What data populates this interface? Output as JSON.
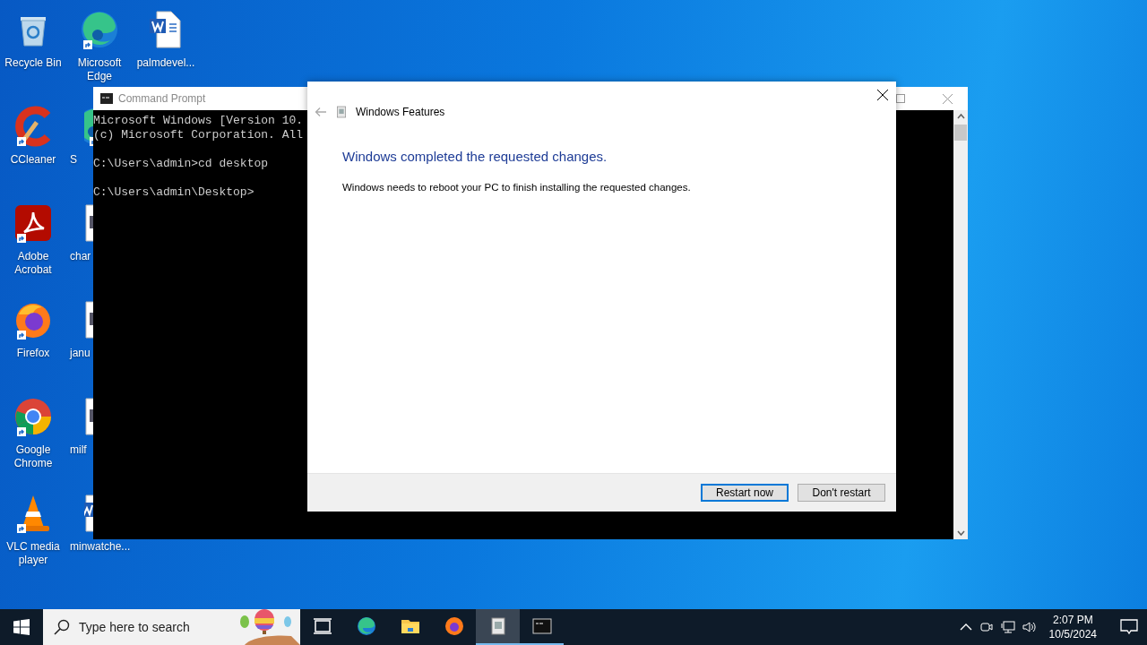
{
  "desktop_columns": [
    [
      {
        "label": "Recycle Bin",
        "kind": "recycle",
        "shortcut": false
      },
      {
        "label": "CCleaner",
        "kind": "ccleaner",
        "shortcut": true
      },
      {
        "label": "Adobe Acrobat",
        "kind": "acrobat",
        "shortcut": true
      },
      {
        "label": "Firefox",
        "kind": "firefox",
        "shortcut": true
      },
      {
        "label": "Google Chrome",
        "kind": "chrome",
        "shortcut": true
      },
      {
        "label": "VLC media player",
        "kind": "vlc",
        "shortcut": true
      }
    ],
    [
      {
        "label": "Microsoft Edge",
        "kind": "edge",
        "shortcut": true
      },
      {
        "label": "S",
        "kind": "edge",
        "shortcut": true
      },
      {
        "label": "char",
        "kind": "doc",
        "shortcut": false
      },
      {
        "label": "janu",
        "kind": "doc",
        "shortcut": false
      },
      {
        "label": "milf",
        "kind": "doc",
        "shortcut": false
      },
      {
        "label": "minwatche...",
        "kind": "word",
        "shortcut": false
      }
    ],
    [
      {
        "label": "palmdevel...",
        "kind": "word",
        "shortcut": false
      }
    ]
  ],
  "console_window": {
    "title": "Command Prompt",
    "blocks": [
      [
        "Microsoft Windows [Version 10.",
        "(c) Microsoft Corporation. All"
      ],
      [
        "C:\\Users\\admin>cd desktop"
      ],
      [
        "C:\\Users\\admin\\Desktop>"
      ]
    ]
  },
  "dialog": {
    "title": "Windows Features",
    "heading": "Windows completed the requested changes.",
    "message": "Windows needs to reboot your PC to finish installing the requested changes.",
    "buttons": [
      {
        "label": "Restart now",
        "default": true
      },
      {
        "label": "Don't restart",
        "default": false
      }
    ]
  },
  "taskbar": {
    "search": {
      "placeholder": "Type here to search"
    },
    "apps": [
      {
        "kind": "taskview",
        "selected": false,
        "open": false
      },
      {
        "kind": "edge",
        "selected": false,
        "open": false
      },
      {
        "kind": "folder",
        "selected": false,
        "open": false
      },
      {
        "kind": "firefox",
        "selected": false,
        "open": false
      },
      {
        "kind": "features",
        "selected": true,
        "open": true
      },
      {
        "kind": "console",
        "selected": false,
        "open": true
      }
    ],
    "clock": {
      "time": "2:07 PM",
      "date": "10/5/2024"
    }
  }
}
